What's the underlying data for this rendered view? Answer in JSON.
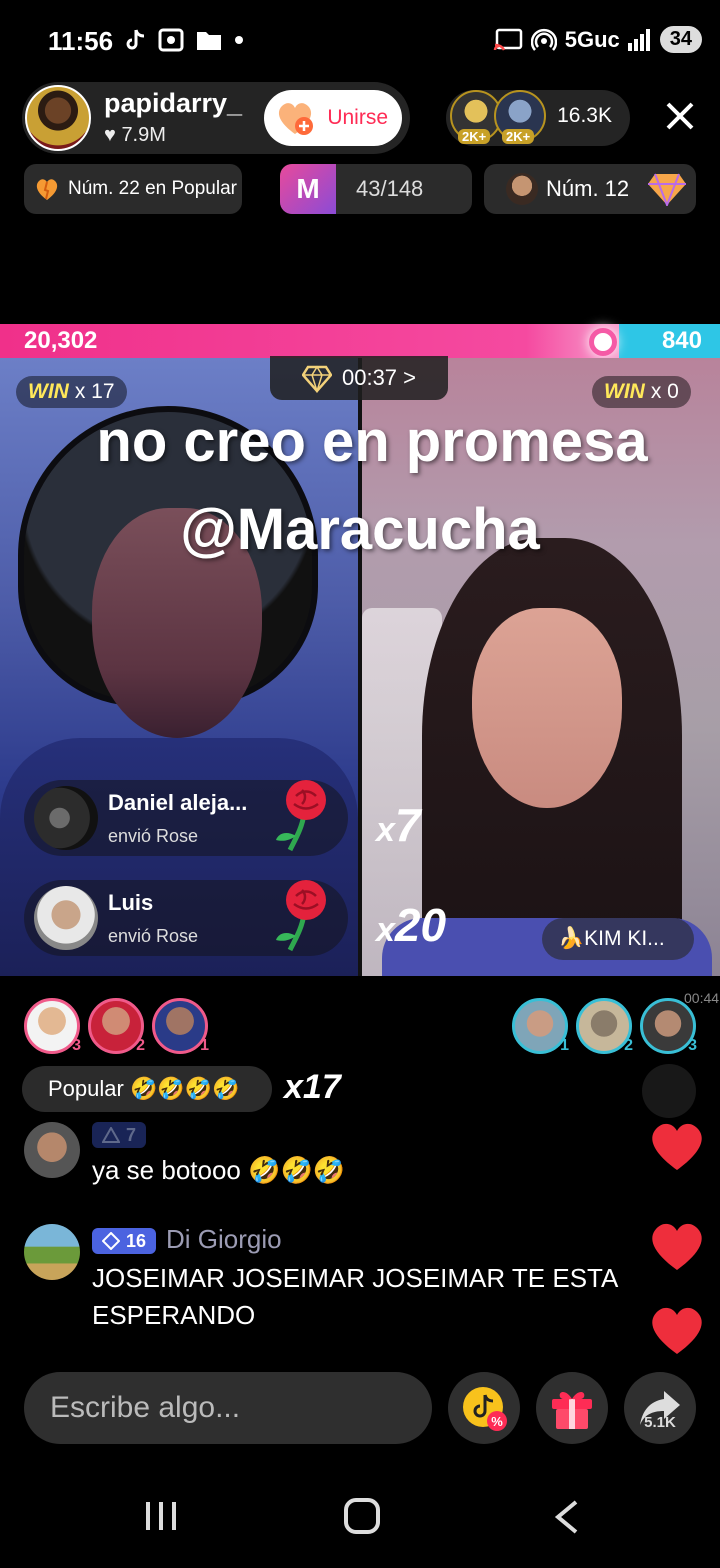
{
  "status": {
    "time": "11:56",
    "network": "5Guc",
    "battery": "34"
  },
  "host": {
    "name": "papidarry_",
    "likes": "7.9M",
    "join_label": "Unirse"
  },
  "viewers": {
    "badge_1": "2K+",
    "badge_2": "2K+",
    "count": "16.3K"
  },
  "pills": {
    "rank_popular": "Núm. 22 en Popular",
    "progress_icon": "M",
    "progress_value": "43/148",
    "rank_number": "Núm. 12"
  },
  "battle": {
    "left_score": "20,302",
    "right_score": "840",
    "timer": "00:37 >",
    "left_win_label": "WIN",
    "left_win_count": "x 17",
    "right_win_label": "WIN",
    "right_win_count": "x 0",
    "overlay_line_1": "no creo en promesa",
    "overlay_line_2": "@Maracucha",
    "left_score_fraction": 0.96
  },
  "gifts": [
    {
      "name": "Daniel aleja...",
      "action": "envió Rose",
      "combo_x": "x",
      "combo_n": "7"
    },
    {
      "name": "Luis",
      "action": "envió Rose",
      "combo_x": "x",
      "combo_n": "20"
    }
  ],
  "guest_label": "🍌KIM KI...",
  "rankings": {
    "left": [
      "3",
      "2",
      "1"
    ],
    "right": [
      "1",
      "2",
      "3"
    ],
    "timer_small": "00:44"
  },
  "popular": {
    "label": "Popular 🤣🤣🤣🤣",
    "combo": "x17"
  },
  "comments": [
    {
      "badge": "7",
      "user": "",
      "text": "ya se botooo 🤣🤣🤣"
    },
    {
      "badge": "16",
      "user": "Di Giorgio",
      "text": "JOSEIMAR JOSEIMAR JOSEIMAR TE ESTA ESPERANDO"
    }
  ],
  "input": {
    "placeholder": "Escribe algo..."
  },
  "share_count": "5.1K",
  "colors": {
    "accent_pink": "#fe2c55",
    "team_red": "#f0308a",
    "team_blue": "#2ec6e6",
    "win_yellow": "#ffe85a"
  }
}
